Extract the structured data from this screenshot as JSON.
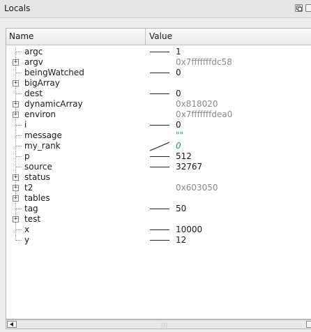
{
  "panel": {
    "title": "Locals"
  },
  "columns": {
    "name": "Name",
    "value": "Value"
  },
  "rows": [
    {
      "name": "argc",
      "value": "1",
      "expandable": false,
      "changed": true,
      "style": "normal"
    },
    {
      "name": "argv",
      "value": "0x7fffffffdc58",
      "expandable": true,
      "changed": false,
      "style": "gray"
    },
    {
      "name": "beingWatched",
      "value": "0",
      "expandable": false,
      "changed": true,
      "style": "normal"
    },
    {
      "name": "bigArray",
      "value": "",
      "expandable": true,
      "changed": false,
      "style": "normal"
    },
    {
      "name": "dest",
      "value": "0",
      "expandable": false,
      "changed": true,
      "style": "normal"
    },
    {
      "name": "dynamicArray",
      "value": "0x818020",
      "expandable": true,
      "changed": false,
      "style": "gray"
    },
    {
      "name": "environ",
      "value": "0x7fffffffdea0",
      "expandable": true,
      "changed": false,
      "style": "gray"
    },
    {
      "name": "i",
      "value": "0",
      "expandable": false,
      "changed": true,
      "style": "normal"
    },
    {
      "name": "message",
      "value": "\"\"",
      "expandable": false,
      "changed": false,
      "style": "green"
    },
    {
      "name": "my_rank",
      "value": "0",
      "expandable": false,
      "changed": "diag",
      "style": "green-italic"
    },
    {
      "name": "p",
      "value": "512",
      "expandable": false,
      "changed": true,
      "style": "normal"
    },
    {
      "name": "source",
      "value": "32767",
      "expandable": false,
      "changed": true,
      "style": "normal"
    },
    {
      "name": "status",
      "value": "",
      "expandable": true,
      "changed": false,
      "style": "normal"
    },
    {
      "name": "t2",
      "value": "0x603050",
      "expandable": true,
      "changed": false,
      "style": "gray"
    },
    {
      "name": "tables",
      "value": "",
      "expandable": true,
      "changed": false,
      "style": "normal"
    },
    {
      "name": "tag",
      "value": "50",
      "expandable": false,
      "changed": true,
      "style": "normal"
    },
    {
      "name": "test",
      "value": "",
      "expandable": true,
      "changed": false,
      "style": "normal"
    },
    {
      "name": "x",
      "value": "10000",
      "expandable": false,
      "changed": true,
      "style": "normal"
    },
    {
      "name": "y",
      "value": "12",
      "expandable": false,
      "changed": true,
      "style": "normal"
    }
  ],
  "icons": {
    "float": "float-panel-icon",
    "close": "close-panel-icon",
    "expander": "plus-expander-icon",
    "scroll_left": "scroll-left-arrow-icon",
    "scroll_right": "scroll-right-arrow-icon"
  },
  "colors": {
    "gray_value": "#8a8a8a",
    "green_value": "#2e9b2e"
  }
}
